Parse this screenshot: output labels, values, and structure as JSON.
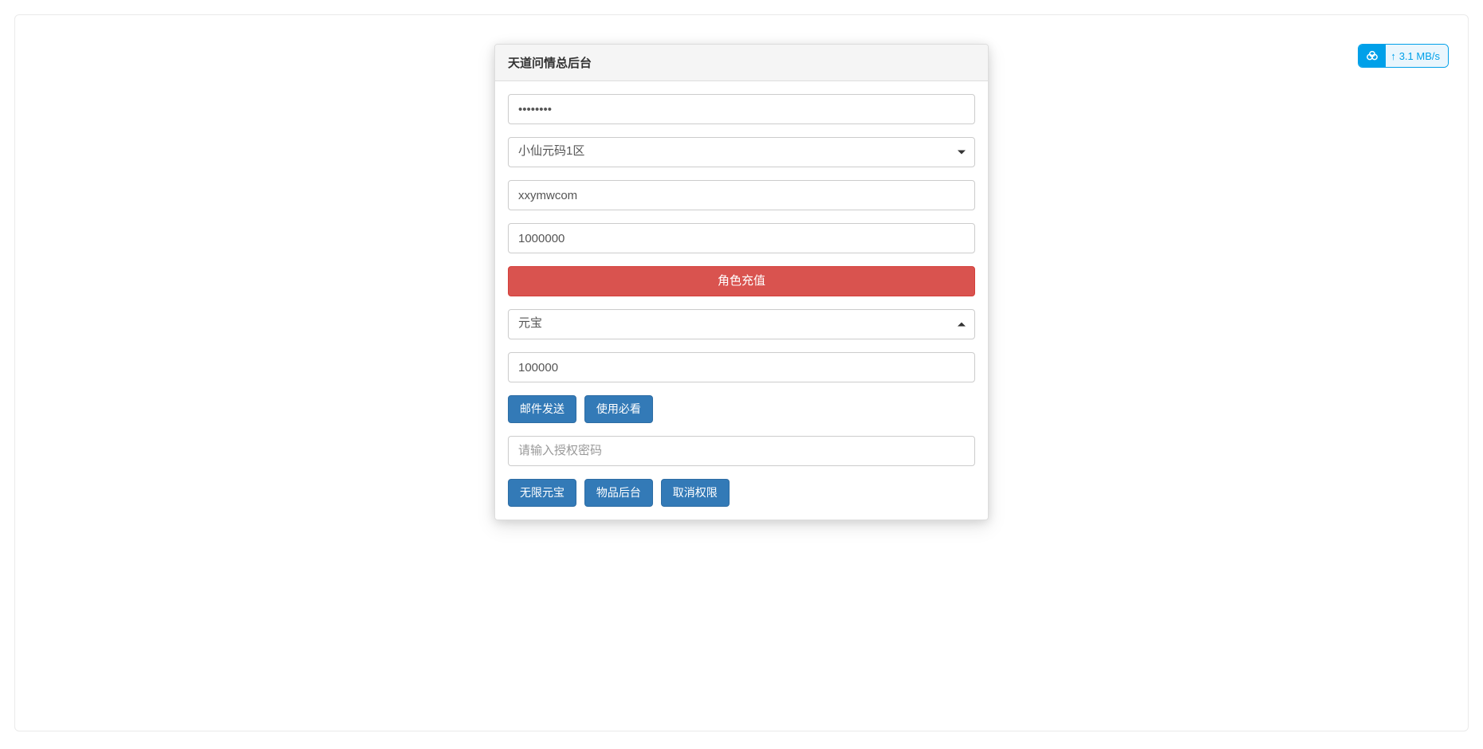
{
  "panel": {
    "title": "天道问情总后台"
  },
  "form": {
    "password_value": "••••••••",
    "server_selected": "小仙元码1区",
    "account_value": "xxymwcom",
    "amount_value": "1000000",
    "recharge_button": "角色充值",
    "currency_selected": "元宝",
    "currency_amount": "100000",
    "mail_send_button": "邮件发送",
    "usage_guide_button": "使用必看",
    "auth_placeholder": "请输入授权密码",
    "unlimited_button": "无限元宝",
    "item_backend_button": "物品后台",
    "cancel_auth_button": "取消权限"
  },
  "speed_widget": {
    "rate": "3.1 MB/s"
  }
}
